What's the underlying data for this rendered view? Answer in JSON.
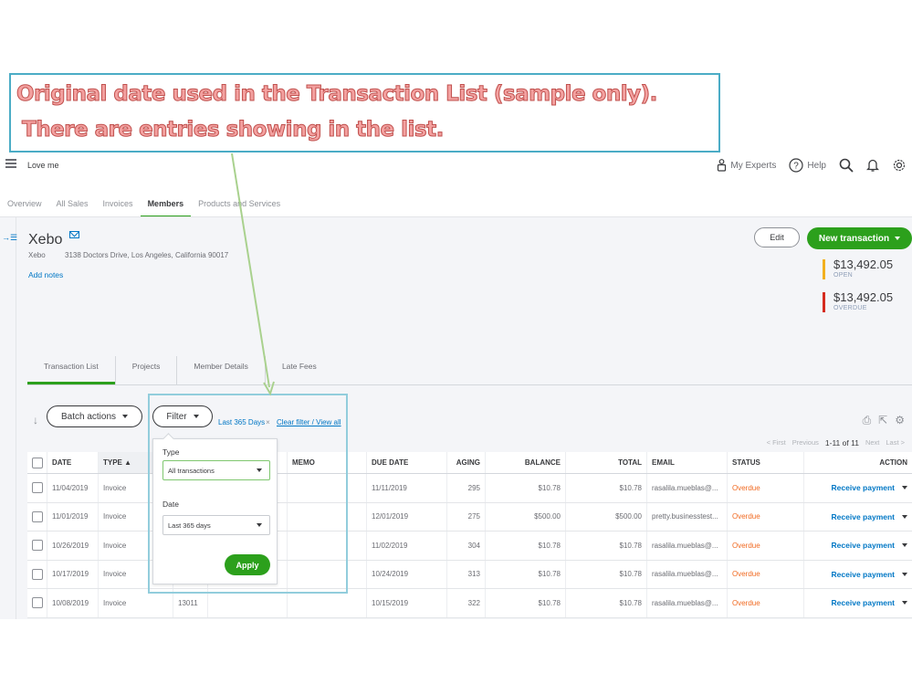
{
  "annotation": {
    "line1": "Original date used in the Transaction List (sample only).",
    "line2": "There are entries showing in the list."
  },
  "topbar": {
    "company": "Love me",
    "my_experts": "My Experts",
    "help": "Help"
  },
  "nav_tabs": [
    {
      "label": "Overview"
    },
    {
      "label": "All Sales"
    },
    {
      "label": "Invoices"
    },
    {
      "label": "Members",
      "active": true
    },
    {
      "label": "Products and Services"
    }
  ],
  "customer": {
    "name": "Xebo",
    "company": "Xebo",
    "address": "3138 Doctors Drive, Los Angeles, California 90017",
    "add_notes": "Add notes"
  },
  "header_actions": {
    "edit": "Edit",
    "new_transaction": "New transaction"
  },
  "balances": {
    "open_amount": "$13,492.05",
    "open_label": "OPEN",
    "overdue_amount": "$13,492.05",
    "overdue_label": "OVERDUE"
  },
  "sub_tabs": [
    {
      "label": "Transaction List",
      "active": true
    },
    {
      "label": "Projects"
    },
    {
      "label": "Member Details"
    },
    {
      "label": "Late Fees"
    }
  ],
  "toolbar": {
    "batch_actions": "Batch actions",
    "filter": "Filter",
    "filter_chip": "Last 365 Days",
    "clear_filter": "Clear filter / View all"
  },
  "pager": {
    "first": "< First",
    "previous": "Previous",
    "count": "1-11 of 11",
    "next": "Next",
    "last": "Last >"
  },
  "filter_popup": {
    "type_label": "Type",
    "type_value": "All transactions",
    "date_label": "Date",
    "date_value": "Last 365 days",
    "apply": "Apply"
  },
  "table": {
    "columns": {
      "date": "DATE",
      "type": "TYPE ▲",
      "no": "",
      "customer": "",
      "memo": "MEMO",
      "due_date": "DUE DATE",
      "aging": "AGING",
      "balance": "BALANCE",
      "total": "TOTAL",
      "email": "EMAIL",
      "status": "STATUS",
      "action": "ACTION"
    },
    "rows": [
      {
        "date": "11/04/2019",
        "type": "Invoice",
        "no": "",
        "memo": "",
        "due_date": "11/11/2019",
        "aging": "295",
        "balance": "$10.78",
        "total": "$10.78",
        "email": "rasalila.mueblas@...",
        "status": "Overdue",
        "action": "Receive payment"
      },
      {
        "date": "11/01/2019",
        "type": "Invoice",
        "no": "",
        "memo": "",
        "due_date": "12/01/2019",
        "aging": "275",
        "balance": "$500.00",
        "total": "$500.00",
        "email": "pretty.businesstest...",
        "status": "Overdue",
        "action": "Receive payment"
      },
      {
        "date": "10/26/2019",
        "type": "Invoice",
        "no": "",
        "memo": "",
        "due_date": "11/02/2019",
        "aging": "304",
        "balance": "$10.78",
        "total": "$10.78",
        "email": "rasalila.mueblas@...",
        "status": "Overdue",
        "action": "Receive payment"
      },
      {
        "date": "10/17/2019",
        "type": "Invoice",
        "no": "",
        "memo": "",
        "due_date": "10/24/2019",
        "aging": "313",
        "balance": "$10.78",
        "total": "$10.78",
        "email": "rasalila.mueblas@...",
        "status": "Overdue",
        "action": "Receive payment"
      },
      {
        "date": "10/08/2019",
        "type": "Invoice",
        "no": "13011",
        "memo": "",
        "due_date": "10/15/2019",
        "aging": "322",
        "balance": "$10.78",
        "total": "$10.78",
        "email": "rasalila.mueblas@...",
        "status": "Overdue",
        "action": "Receive payment"
      }
    ]
  },
  "colors": {
    "brand_green": "#2ca01c",
    "link_blue": "#0077c5",
    "overdue_orange": "#f16a21",
    "open_bar": "#f2b01e",
    "overdue_bar": "#d52b1e",
    "annotation_border": "#4bacc6",
    "annotation_text": "#c0504d",
    "arrow": "#a9d18e"
  }
}
